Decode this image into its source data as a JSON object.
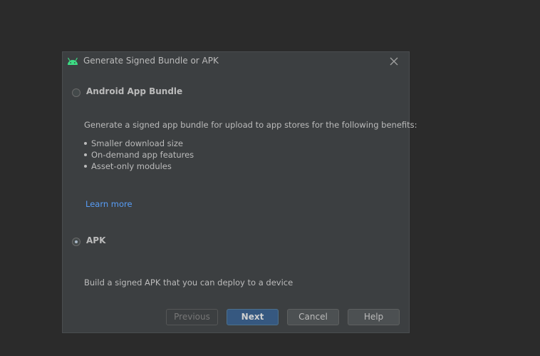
{
  "dialog": {
    "title": "Generate Signed Bundle or APK",
    "icon": "android-icon"
  },
  "options": {
    "bundle": {
      "label": "Android App Bundle",
      "selected": false,
      "description": "Generate a signed app bundle for upload to app stores for the following benefits:",
      "benefits": [
        "Smaller download size",
        "On-demand app features",
        "Asset-only modules"
      ],
      "learn_more": "Learn more"
    },
    "apk": {
      "label": "APK",
      "selected": true,
      "description": "Build a signed APK that you can deploy to a device"
    }
  },
  "buttons": {
    "previous": "Previous",
    "next": "Next",
    "cancel": "Cancel",
    "help": "Help"
  },
  "colors": {
    "background": "#2b2b2b",
    "dialog": "#3c3f41",
    "link": "#589df6",
    "default_button": "#365880",
    "android_green": "#3ddc84"
  }
}
